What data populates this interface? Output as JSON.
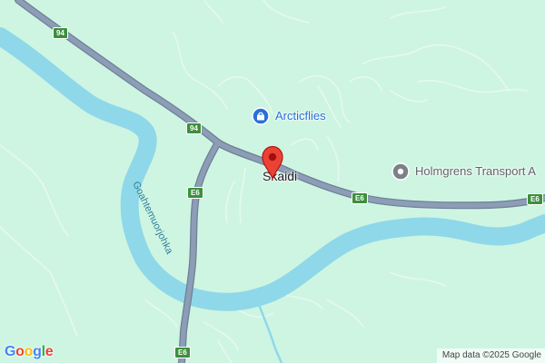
{
  "map": {
    "place": {
      "name": "Skaidi"
    },
    "pois": [
      {
        "name": "Arcticflies",
        "icon": "shopping-bag-icon",
        "color": "#2a6fdb"
      },
      {
        "name": "Holmgrens Transport A",
        "icon": "poi-dot-icon",
        "color": "#5f6368"
      }
    ],
    "water": {
      "river_name": "Goahtemuorjohka"
    },
    "roads": {
      "shields": [
        {
          "id": "94",
          "label": "94"
        },
        {
          "id": "94b",
          "label": "94"
        },
        {
          "id": "e6a",
          "label": "E6"
        },
        {
          "id": "e6b",
          "label": "E6"
        },
        {
          "id": "e6c",
          "label": "E6"
        },
        {
          "id": "e6d",
          "label": "E6"
        }
      ]
    },
    "marker": {
      "color": "#ea4335"
    },
    "branding": {
      "logo_letters": [
        "G",
        "o",
        "o",
        "g",
        "l",
        "e"
      ],
      "logo_colors": [
        "#4285f4",
        "#ea4335",
        "#fbbc05",
        "#4285f4",
        "#34a853",
        "#ea4335"
      ]
    },
    "attribution": "Map data ©2025 Google",
    "colors": {
      "land": "#cef5e2",
      "water": "#8fd8e9",
      "road": "#8c9db5",
      "road_casing": "#6b7d96",
      "contour": "#e4f7ee",
      "shield": "#3d8f3d"
    }
  }
}
